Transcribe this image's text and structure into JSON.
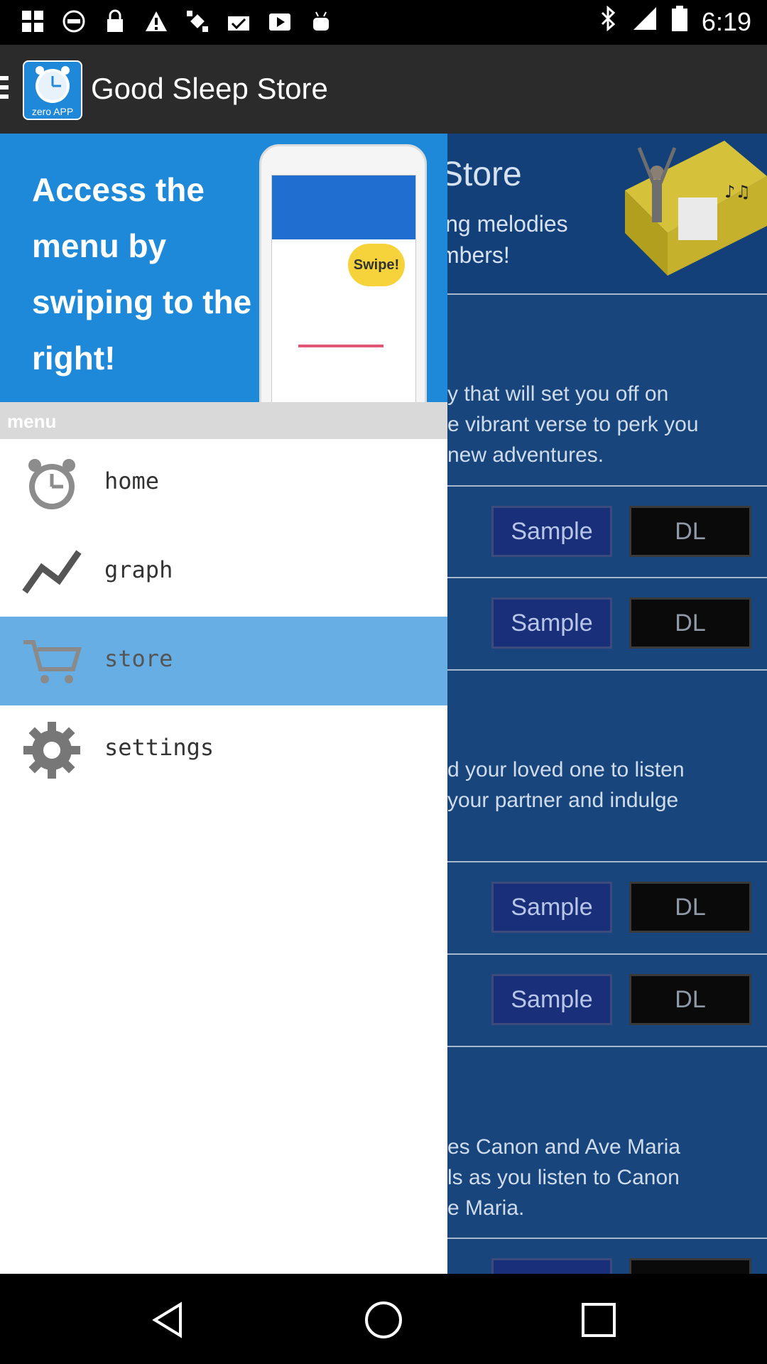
{
  "status_bar": {
    "time": "6:19",
    "icons": [
      "grid-icon",
      "block-icon",
      "lock-icon",
      "warning-icon",
      "satellite-icon",
      "check-box-icon",
      "play-icon",
      "android-icon",
      "bluetooth-icon",
      "signal-icon",
      "battery-icon"
    ]
  },
  "app_bar": {
    "title": "Good Sleep Store",
    "app_icon_label": "zero APP"
  },
  "store": {
    "header_title": "Store",
    "header_sub": [
      "ing melodies",
      "mbers!"
    ],
    "sections": [
      {
        "desc": [
          "y that will set you off on",
          "e vibrant verse to perk you",
          "new adventures."
        ]
      },
      {
        "desc": [
          "d your loved one to listen",
          "your partner and indulge"
        ]
      },
      {
        "desc": [
          "es Canon and Ave Maria",
          "ls as you listen to Canon",
          "e Maria."
        ]
      }
    ],
    "sample_label": "Sample",
    "dl_label": "DL"
  },
  "drawer": {
    "banner_text": "Access the menu by swiping to the right!",
    "banner_bubble": "Swipe!",
    "menu_header": "menu",
    "items": [
      {
        "label": "home",
        "icon": "clock-icon",
        "active": false
      },
      {
        "label": "graph",
        "icon": "graph-icon",
        "active": false
      },
      {
        "label": "store",
        "icon": "cart-icon",
        "active": true
      },
      {
        "label": "settings",
        "icon": "gear-icon",
        "active": false
      }
    ]
  },
  "nav": {
    "icons": [
      "back-icon",
      "home-icon",
      "recents-icon"
    ]
  }
}
